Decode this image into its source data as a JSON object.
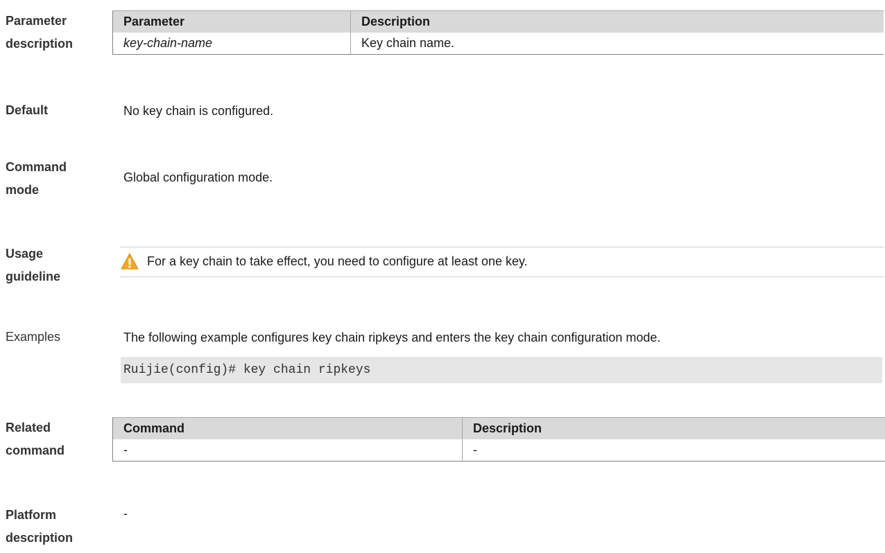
{
  "sections": {
    "parameter_description": {
      "label_lines": [
        "Parameter",
        "description"
      ],
      "table": {
        "headers": [
          "Parameter",
          "Description"
        ],
        "rows": [
          [
            "key-chain-name",
            "Key chain name."
          ]
        ]
      }
    },
    "default": {
      "label_lines": [
        "Default"
      ],
      "text": "No key chain is configured."
    },
    "command_mode": {
      "label_lines": [
        "Command",
        "mode"
      ],
      "text": "Global configuration mode."
    },
    "usage_guideline": {
      "label_lines": [
        "Usage",
        "guideline"
      ],
      "note_icon": "warning-triangle-icon",
      "note": "For a key chain to take effect, you need to configure at least one key."
    },
    "examples": {
      "label_lines": [
        "Examples"
      ],
      "text": "The following example configures key chain ripkeys and enters the key chain configuration mode.",
      "code": "Ruijie(config)# key chain ripkeys"
    },
    "related_command": {
      "label_lines": [
        "Related",
        "command"
      ],
      "table": {
        "headers": [
          "Command",
          "Description"
        ],
        "rows": [
          [
            "-",
            "-"
          ]
        ]
      }
    },
    "platform_description": {
      "label_lines": [
        "Platform",
        "description"
      ],
      "text": "-"
    }
  },
  "colors": {
    "table_header_bg": "#d9d9d9",
    "code_bg": "#e6e6e6",
    "warning": "#f5a623"
  }
}
